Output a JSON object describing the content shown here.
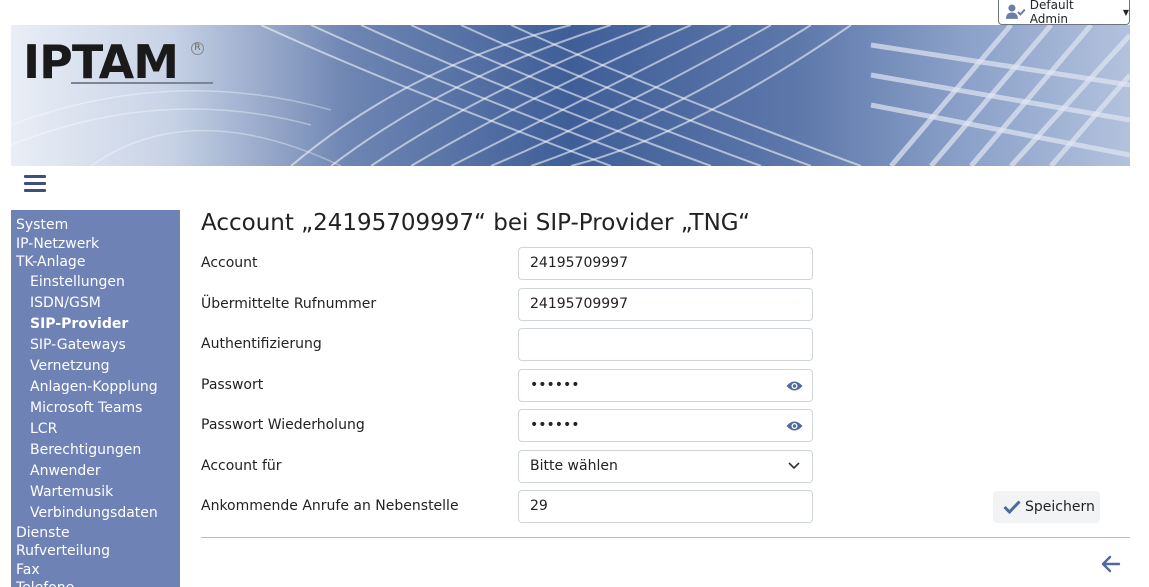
{
  "user_menu": {
    "label": "Default Admin"
  },
  "banner": {
    "logo_text": "IPTAM",
    "logo_reg": "R"
  },
  "sidebar": {
    "items": [
      {
        "label": "System",
        "level": 0,
        "active": false
      },
      {
        "label": "IP-Netzwerk",
        "level": 0,
        "active": false
      },
      {
        "label": "TK-Anlage",
        "level": 0,
        "active": false
      },
      {
        "label": "Einstellungen",
        "level": 1,
        "active": false
      },
      {
        "label": "ISDN/GSM",
        "level": 1,
        "active": false
      },
      {
        "label": "SIP-Provider",
        "level": 1,
        "active": true
      },
      {
        "label": "SIP-Gateways",
        "level": 1,
        "active": false
      },
      {
        "label": "Vernetzung",
        "level": 1,
        "active": false
      },
      {
        "label": "Anlagen-Kopplung",
        "level": 1,
        "active": false
      },
      {
        "label": "Microsoft Teams",
        "level": 1,
        "active": false
      },
      {
        "label": "LCR",
        "level": 1,
        "active": false
      },
      {
        "label": "Berechtigungen",
        "level": 1,
        "active": false
      },
      {
        "label": "Anwender",
        "level": 1,
        "active": false
      },
      {
        "label": "Wartemusik",
        "level": 1,
        "active": false
      },
      {
        "label": "Verbindungsdaten",
        "level": 1,
        "active": false
      },
      {
        "label": "Dienste",
        "level": 0,
        "active": false
      },
      {
        "label": "Rufverteilung",
        "level": 0,
        "active": false
      },
      {
        "label": "Fax",
        "level": 0,
        "active": false
      },
      {
        "label": "Telefone",
        "level": 0,
        "active": false
      }
    ]
  },
  "page": {
    "title": "Account „24195709997“ bei SIP-Provider „TNG“"
  },
  "form": {
    "account": {
      "label": "Account",
      "value": "24195709997"
    },
    "caller_id": {
      "label": "Übermittelte Rufnummer",
      "value": "24195709997"
    },
    "auth": {
      "label": "Authentifizierung",
      "value": ""
    },
    "password": {
      "label": "Passwort",
      "value": "••••••"
    },
    "password_repeat": {
      "label": "Passwort Wiederholung",
      "value": "••••••"
    },
    "account_for": {
      "label": "Account für",
      "value": "Bitte wählen"
    },
    "incoming": {
      "label": "Ankommende Anrufe an Nebenstelle",
      "value": "29"
    }
  },
  "actions": {
    "save_label": "Speichern"
  },
  "colors": {
    "sidebar_bg": "#6f82b5",
    "accent": "#3d5a99",
    "divider": "#b9bec5"
  }
}
